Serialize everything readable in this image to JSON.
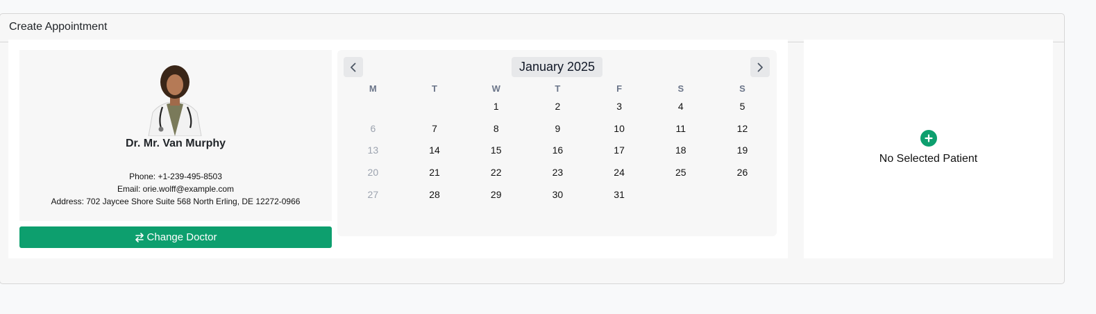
{
  "header": {
    "title": "Create Appointment"
  },
  "doctor": {
    "name": "Dr. Mr. Van Murphy",
    "phone": "Phone: +1-239-495-8503",
    "email": "Email: orie.wolff@example.com",
    "address": "Address: 702 Jaycee Shore Suite 568 North Erling, DE 12272-0966",
    "change_label": "Change Doctor"
  },
  "calendar": {
    "month_label": "January 2025",
    "weekdays": [
      "M",
      "T",
      "W",
      "T",
      "F",
      "S",
      "S"
    ],
    "cells": [
      {
        "d": ""
      },
      {
        "d": ""
      },
      {
        "d": "1"
      },
      {
        "d": "2"
      },
      {
        "d": "3"
      },
      {
        "d": "4"
      },
      {
        "d": "5"
      },
      {
        "d": "6",
        "muted": true
      },
      {
        "d": "7"
      },
      {
        "d": "8"
      },
      {
        "d": "9"
      },
      {
        "d": "10"
      },
      {
        "d": "11"
      },
      {
        "d": "12"
      },
      {
        "d": "13",
        "muted": true
      },
      {
        "d": "14"
      },
      {
        "d": "15"
      },
      {
        "d": "16"
      },
      {
        "d": "17"
      },
      {
        "d": "18"
      },
      {
        "d": "19"
      },
      {
        "d": "20",
        "muted": true
      },
      {
        "d": "21"
      },
      {
        "d": "22"
      },
      {
        "d": "23"
      },
      {
        "d": "24"
      },
      {
        "d": "25"
      },
      {
        "d": "26"
      },
      {
        "d": "27",
        "muted": true
      },
      {
        "d": "28"
      },
      {
        "d": "29"
      },
      {
        "d": "30"
      },
      {
        "d": "31"
      },
      {
        "d": ""
      },
      {
        "d": ""
      }
    ]
  },
  "patient": {
    "empty_label": "No Selected Patient"
  },
  "colors": {
    "accent": "#0d9f6e",
    "muted_day": "#9ca3af",
    "weekday": "#6b7589"
  },
  "icons": {
    "prev": "chevron-left-icon",
    "next": "chevron-right-icon",
    "swap": "swap-icon",
    "add": "plus-icon"
  }
}
